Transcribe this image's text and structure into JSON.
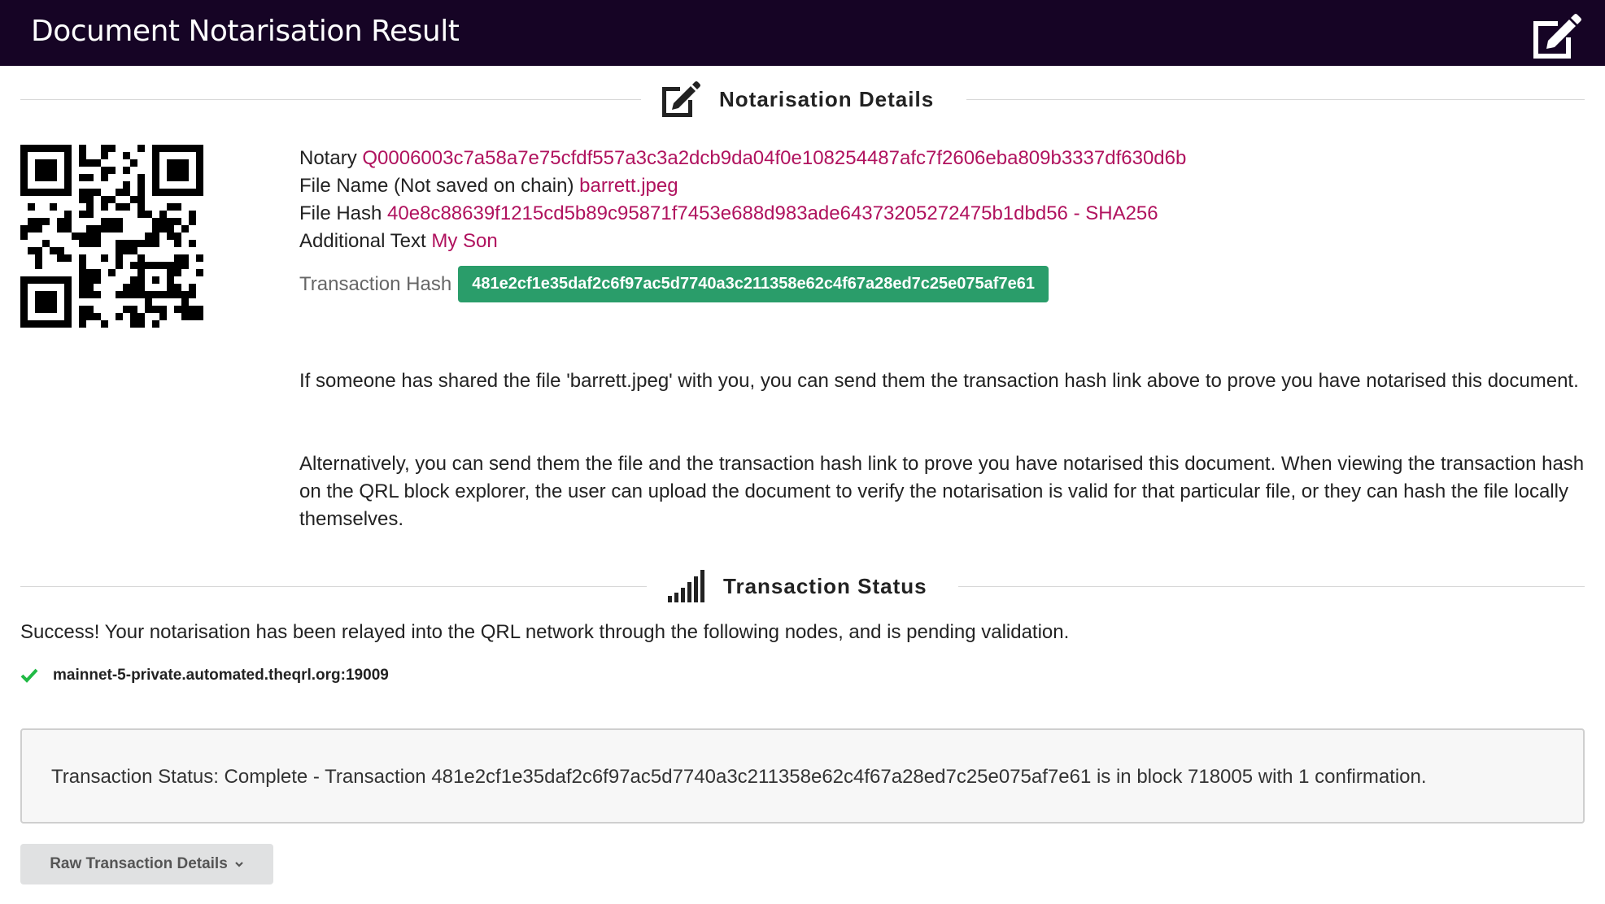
{
  "header": {
    "title": "Document Notarisation Result",
    "icon": "edit-icon"
  },
  "notarisation_section": {
    "title": "Notarisation Details",
    "icon": "edit-icon"
  },
  "details": {
    "qr_icon": "qr-code",
    "notary_label": "Notary",
    "notary_value": "Q0006003c7a58a7e75cfdf557a3c3a2dcb9da04f0e108254487afc7f2606eba809b3337df630d6b",
    "file_name_label": "File Name (Not saved on chain)",
    "file_name_value": "barrett.jpeg",
    "file_hash_label": "File Hash",
    "file_hash_value": "40e8c88639f1215cd5b89c95871f7453e688d983ade64373205272475b1dbd56 - SHA256",
    "additional_text_label": "Additional Text",
    "additional_text_value": "My Son",
    "tx_hash_label": "Transaction Hash",
    "tx_hash_value": "481e2cf1e35daf2c6f97ac5d7740a3c211358e62c4f67a28ed7c25e075af7e61"
  },
  "paragraphs": {
    "p1": "If someone has shared the file 'barrett.jpeg' with you, you can send them the transaction hash link above to prove you have notarised this document.",
    "p2": "Alternatively, you can send them the file and the transaction hash link to prove you have notarised this document. When viewing the transaction hash on the QRL block explorer, the user can upload the document to verify the notarisation is valid for that particular file, or they can hash the file locally themselves."
  },
  "status_section": {
    "title": "Transaction Status",
    "icon": "signal-bars-icon",
    "success_message": "Success! Your notarisation has been relayed into the QRL network through the following nodes, and is pending validation.",
    "nodes": [
      "mainnet-5-private.automated.theqrl.org:19009"
    ],
    "status_text": "Transaction Status: Complete - Transaction 481e2cf1e35daf2c6f97ac5d7740a3c211358e62c4f67a28ed7c25e075af7e61 is in block 718005 with 1 confirmation."
  },
  "raw_button": {
    "label": "Raw Transaction Details",
    "icon": "chevron-down-icon"
  },
  "colors": {
    "header_bg": "#160425",
    "accent_value": "#b0125e",
    "tx_badge": "#2a9d6a",
    "check": "#21ba45"
  }
}
